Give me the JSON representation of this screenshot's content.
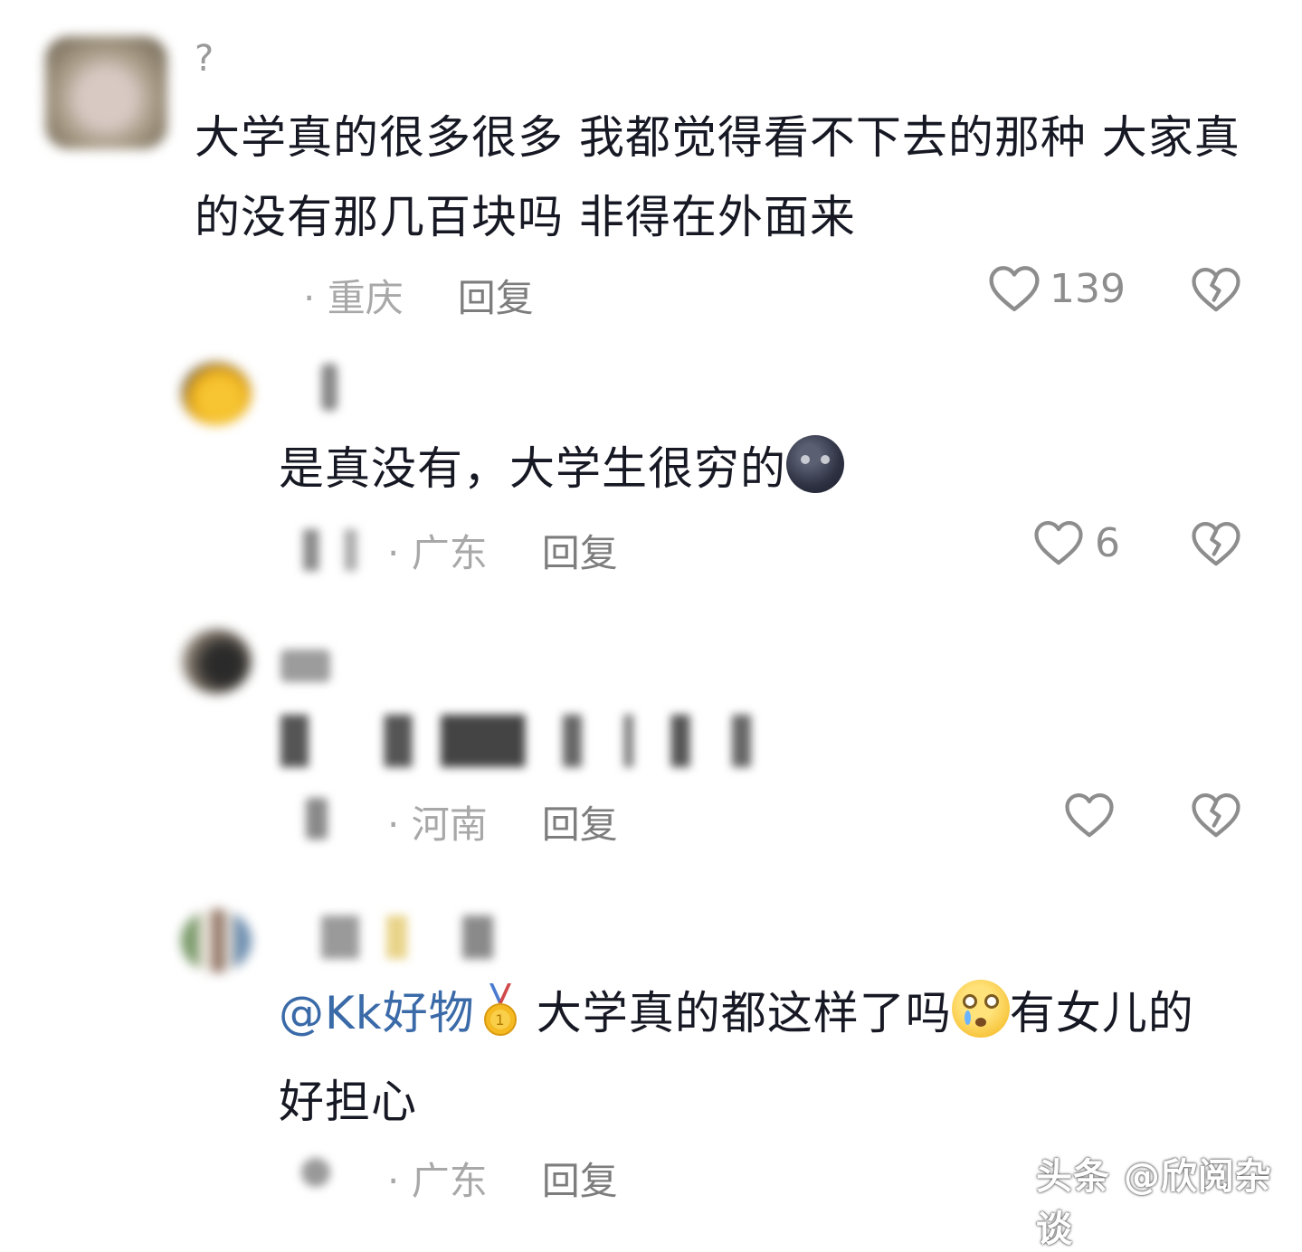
{
  "comments": [
    {
      "username": "?",
      "content_lines": [
        "大学真的很多很多 我都觉得看不下去的那种 大家真",
        "的没有那几百块吗 非得在外面来"
      ],
      "location": "· 重庆",
      "reply_label": "回复",
      "likes": "139"
    },
    {
      "content": "是真没有，大学生很穷的",
      "location": "· 广东",
      "reply_label": "回复",
      "likes": "6"
    },
    {
      "location": "· 河南",
      "reply_label": "回复",
      "likes": ""
    },
    {
      "mention": "@Kk好物",
      "content_part1": "大学真的都这样了吗",
      "content_part2": "有女儿的",
      "content_line2": "好担心",
      "location": "· 广东",
      "reply_label": "回复"
    }
  ],
  "watermark": "头条 @欣阅杂谈",
  "icons": {
    "like": "heart-outline-icon",
    "dislike": "broken-heart-icon"
  },
  "colors": {
    "text": "#161823",
    "meta": "#a8a8a8",
    "mention": "#3a6aa8"
  }
}
